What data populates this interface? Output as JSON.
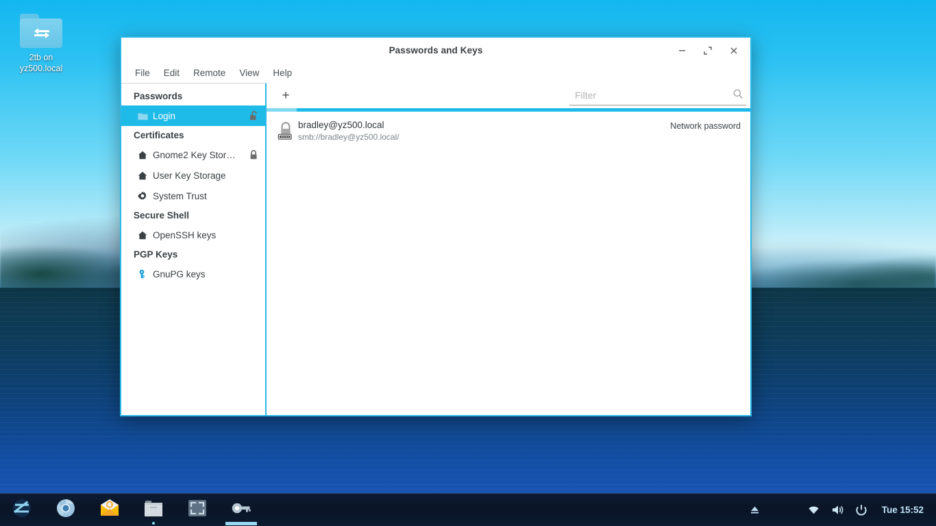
{
  "desktop": {
    "icon": {
      "name": "folder-network-icon",
      "label_line1": "2tb on",
      "label_line2": "yz500.local"
    }
  },
  "window": {
    "title": "Passwords and Keys",
    "controls": {
      "minimize": "minimize-icon",
      "maximize": "maximize-icon",
      "close": "close-icon"
    },
    "menubar": [
      {
        "label": "File"
      },
      {
        "label": "Edit"
      },
      {
        "label": "Remote"
      },
      {
        "label": "View"
      },
      {
        "label": "Help"
      }
    ],
    "sidebar": {
      "groups": [
        {
          "header": "Passwords",
          "items": [
            {
              "label": "Login",
              "icon": "keyring-folder-icon",
              "trailing_icon": "padlock-open-icon",
              "selected": true
            }
          ]
        },
        {
          "header": "Certificates",
          "items": [
            {
              "label": "Gnome2 Key Stor…",
              "icon": "home-icon",
              "trailing_icon": "padlock-closed-icon",
              "selected": false
            },
            {
              "label": "User Key Storage",
              "icon": "home-icon",
              "trailing_icon": "",
              "selected": false
            },
            {
              "label": "System Trust",
              "icon": "gear-icon",
              "trailing_icon": "",
              "selected": false
            }
          ]
        },
        {
          "header": "Secure Shell",
          "items": [
            {
              "label": "OpenSSH keys",
              "icon": "home-icon",
              "trailing_icon": "",
              "selected": false
            }
          ]
        },
        {
          "header": "PGP Keys",
          "items": [
            {
              "label": "GnuPG keys",
              "icon": "gnupg-key-icon",
              "trailing_icon": "",
              "selected": false
            }
          ]
        }
      ]
    },
    "toolbar": {
      "add_label": "+",
      "filter_placeholder": "Filter",
      "filter_value": "",
      "search_icon": "search-icon"
    },
    "entries": [
      {
        "icon": "network-password-lock-icon",
        "title": "bradley@yz500.local",
        "subtitle": "smb://bradley@yz500.local/",
        "type": "Network password"
      }
    ]
  },
  "taskbar": {
    "launchers": [
      {
        "name": "zorin-menu",
        "icon": "zorin-logo-icon",
        "running": "none"
      },
      {
        "name": "chromium",
        "icon": "chromium-icon",
        "running": "none"
      },
      {
        "name": "mail",
        "icon": "mail-envelope-icon",
        "running": "none"
      },
      {
        "name": "files",
        "icon": "file-manager-icon",
        "running": "dot"
      },
      {
        "name": "screenshot",
        "icon": "screenshot-icon",
        "running": "none"
      },
      {
        "name": "passwords-and-keys",
        "icon": "key-icon",
        "running": "bar"
      }
    ],
    "tray": [
      {
        "name": "eject",
        "icon": "eject-icon"
      },
      {
        "name": "network",
        "icon": "wifi-icon"
      },
      {
        "name": "volume",
        "icon": "volume-icon"
      },
      {
        "name": "power",
        "icon": "power-icon"
      }
    ],
    "clock": "Tue 15:52"
  },
  "colors": {
    "accent": "#1fbbe8",
    "accent_light": "#7fd9f2",
    "window_border": "#2bb8e8",
    "taskbar_bg": "#0a1526",
    "clock_text": "#bfe2f7"
  }
}
